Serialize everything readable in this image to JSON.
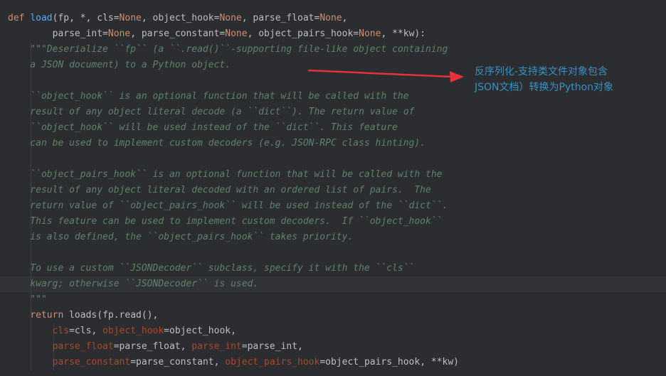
{
  "code": {
    "lines": [
      {
        "tokens": [
          {
            "t": "def",
            "c": "kw"
          },
          {
            "t": " ",
            "c": "tx"
          },
          {
            "t": "load",
            "c": "fn"
          },
          {
            "t": "(fp, *, cls=",
            "c": "tx"
          },
          {
            "t": "None",
            "c": "kw"
          },
          {
            "t": ", object_hook=",
            "c": "tx"
          },
          {
            "t": "None",
            "c": "kw"
          },
          {
            "t": ", parse_float=",
            "c": "tx"
          },
          {
            "t": "None",
            "c": "kw"
          },
          {
            "t": ",",
            "c": "tx"
          }
        ]
      },
      {
        "tokens": [
          {
            "t": "        parse_int=",
            "c": "tx"
          },
          {
            "t": "None",
            "c": "kw"
          },
          {
            "t": ", parse_constant=",
            "c": "tx"
          },
          {
            "t": "None",
            "c": "kw"
          },
          {
            "t": ", object_pairs_hook=",
            "c": "tx"
          },
          {
            "t": "None",
            "c": "kw"
          },
          {
            "t": ", **kw):",
            "c": "tx"
          }
        ]
      },
      {
        "tokens": [
          {
            "t": "    \"\"\"Deserialize ``fp`` (a ``.read()``-supporting file-like object containing",
            "c": "doc"
          }
        ]
      },
      {
        "tokens": [
          {
            "t": "    a JSON document) to a Python object.",
            "c": "doc"
          }
        ]
      },
      {
        "tokens": []
      },
      {
        "tokens": [
          {
            "t": "    ``object_hook`` is an optional function that will be called with the",
            "c": "doc"
          }
        ]
      },
      {
        "tokens": [
          {
            "t": "    result of any object literal decode (a ``dict``). The return value of",
            "c": "doc"
          }
        ]
      },
      {
        "tokens": [
          {
            "t": "    ``object_hook`` will be used instead of the ``dict``. This feature",
            "c": "doc"
          }
        ]
      },
      {
        "tokens": [
          {
            "t": "    can be used to implement custom decoders (e.g. JSON-RPC class hinting).",
            "c": "doc"
          }
        ]
      },
      {
        "tokens": []
      },
      {
        "tokens": [
          {
            "t": "    ``object_pairs_hook`` is an optional function that will be called with the",
            "c": "doc"
          }
        ]
      },
      {
        "tokens": [
          {
            "t": "    result of any object literal decoded with an ordered list of pairs.  The",
            "c": "doc"
          }
        ]
      },
      {
        "tokens": [
          {
            "t": "    return value of ``object_pairs_hook`` will be used instead of the ``dict``.",
            "c": "doc"
          }
        ]
      },
      {
        "tokens": [
          {
            "t": "    This feature can be used to implement custom decoders.  If ``object_hook``",
            "c": "doc"
          }
        ]
      },
      {
        "tokens": [
          {
            "t": "    is also defined, the ``object_pairs_hook`` takes priority.",
            "c": "doc"
          }
        ]
      },
      {
        "tokens": []
      },
      {
        "tokens": [
          {
            "t": "    To use a custom ``JSONDecoder`` subclass, specify it with the ``cls``",
            "c": "doc"
          }
        ]
      },
      {
        "tokens": [
          {
            "t": "    kwarg; otherwise ``JSONDecoder`` is used.",
            "c": "doc"
          }
        ]
      },
      {
        "tokens": [
          {
            "t": "    \"\"\"",
            "c": "doc"
          }
        ]
      },
      {
        "tokens": [
          {
            "t": "    ",
            "c": "tx"
          },
          {
            "t": "return",
            "c": "kw"
          },
          {
            "t": " loads(fp.read(),",
            "c": "tx"
          }
        ]
      },
      {
        "tokens": [
          {
            "t": "        ",
            "c": "tx"
          },
          {
            "t": "cls",
            "c": "pn"
          },
          {
            "t": "=cls, ",
            "c": "tx"
          },
          {
            "t": "object_hook",
            "c": "pn"
          },
          {
            "t": "=object_hook,",
            "c": "tx"
          }
        ]
      },
      {
        "tokens": [
          {
            "t": "        ",
            "c": "tx"
          },
          {
            "t": "parse_float",
            "c": "pn"
          },
          {
            "t": "=parse_float, ",
            "c": "tx"
          },
          {
            "t": "parse_int",
            "c": "pn"
          },
          {
            "t": "=parse_int,",
            "c": "tx"
          }
        ]
      },
      {
        "tokens": [
          {
            "t": "        ",
            "c": "tx"
          },
          {
            "t": "parse_constant",
            "c": "pn"
          },
          {
            "t": "=parse_constant, ",
            "c": "tx"
          },
          {
            "t": "object_pairs_hook",
            "c": "pn"
          },
          {
            "t": "=object_pairs_hook, **kw)",
            "c": "tx"
          }
        ]
      }
    ],
    "highlighted_line": 17
  },
  "annotation": {
    "line1": "反序列化-支持类文件对象包含",
    "line2": "JSON文档）转换为Python对象",
    "color": "#3592c4",
    "arrow_color": "#e8303a"
  },
  "colors": {
    "background": "#2b2d30",
    "keyword": "#cf8e6d",
    "function": "#56a8f5",
    "text": "#bcbec4",
    "docstring": "#5f826b",
    "param": "#aa4926"
  }
}
